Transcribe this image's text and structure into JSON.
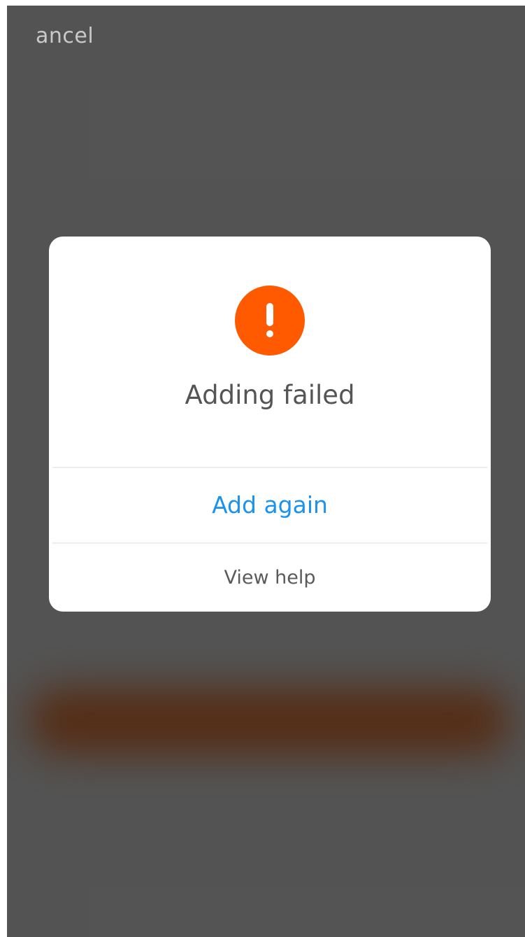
{
  "header": {
    "cancel_label": "ancel"
  },
  "dialog": {
    "icon": "exclamation-circle-icon",
    "icon_color": "#ff5a00",
    "title": "Adding failed",
    "primary_action": "Add again",
    "primary_color": "#1a93f0",
    "secondary_action": "View help"
  }
}
